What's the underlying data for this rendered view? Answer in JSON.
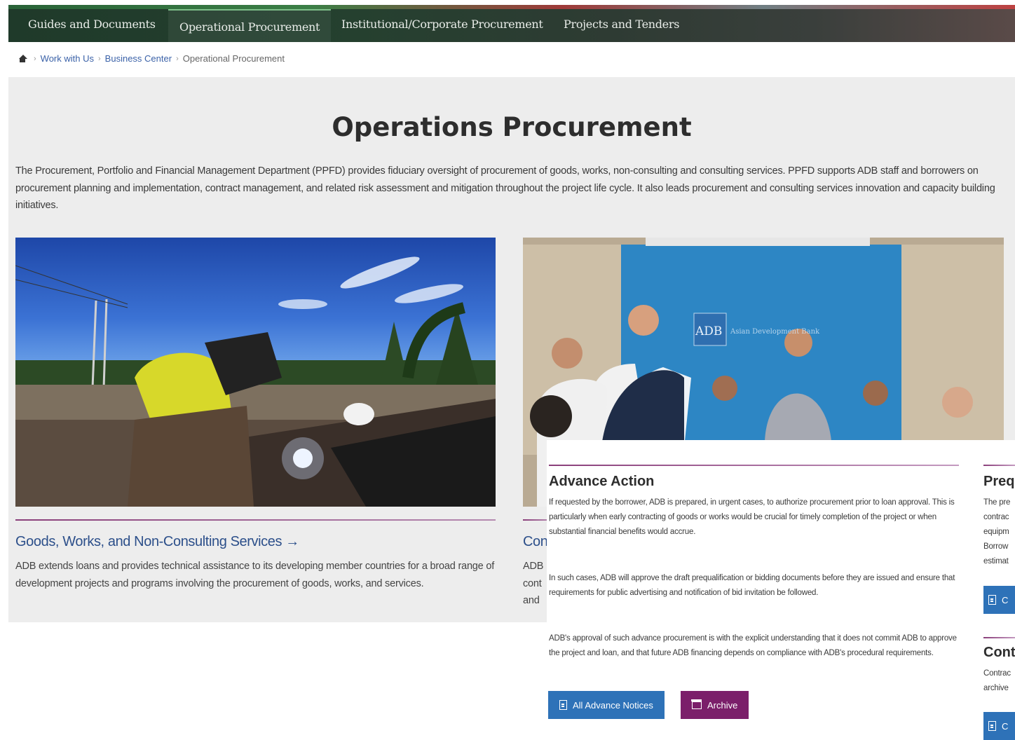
{
  "nav": {
    "items": [
      {
        "label": "Guides and Documents"
      },
      {
        "label": "Operational Procurement"
      },
      {
        "label": "Institutional/Corporate Procurement"
      },
      {
        "label": "Projects and Tenders"
      }
    ]
  },
  "breadcrumb": {
    "items": [
      "Work with Us",
      "Business Center"
    ],
    "current": "Operational Procurement"
  },
  "page": {
    "title": "Operations Procurement",
    "intro": "The Procurement, Portfolio and Financial Management Department (PPFD) provides fiduciary oversight of procurement of goods, works, non-consulting and consulting services. PPFD supports ADB staff and borrowers on procurement planning and implementation, contract management, and related risk assessment and mitigation throughout the project life cycle. It also leads procurement and consulting services innovation and capacity building initiatives."
  },
  "cards": [
    {
      "title": "Goods, Works, and Non-Consulting Services →",
      "body": "ADB extends loans and provides technical assistance to its developing member countries for a broad range of development projects and programs involving the procurement of goods, works, and services."
    },
    {
      "title": "Con",
      "body_lines": [
        "ADB",
        "cont",
        "and"
      ]
    }
  ],
  "photo2": {
    "banner_logo": "ADB",
    "banner_text": "Asian Development Bank"
  },
  "advance_action": {
    "title": "Advance Action",
    "p1": "If requested by the borrower, ADB is prepared, in urgent cases, to authorize procurement prior to loan approval. This is particularly when early contracting of goods or works would be crucial for timely completion of the project or when substantial financial benefits would accrue.",
    "p2": "In such cases, ADB will approve the draft prequalification or bidding documents before they are issued and ensure that requirements for public advertising and notification of bid invitation be followed.",
    "p3": "ADB's approval of such advance procurement is with the explicit understanding that it does not commit ADB to approve the project and loan, and that future ADB financing depends on compliance with ADB's procedural requirements.",
    "btn_notices": "All Advance Notices",
    "btn_archive": "Archive"
  },
  "prequal": {
    "title": "Prequ",
    "lines": [
      "The pre",
      "contrac",
      "equipm",
      "Borrow",
      "estimat"
    ],
    "btn": "C"
  },
  "contract": {
    "title": "Cont",
    "lines": [
      "Contrac",
      "archive"
    ],
    "btn": "C"
  },
  "colors": {
    "nav_bg": "#25402f",
    "link": "#2c4f8a",
    "accent_purple": "#7b1f6a",
    "accent_blue": "#2e72b8",
    "section_bg": "#ededed"
  }
}
